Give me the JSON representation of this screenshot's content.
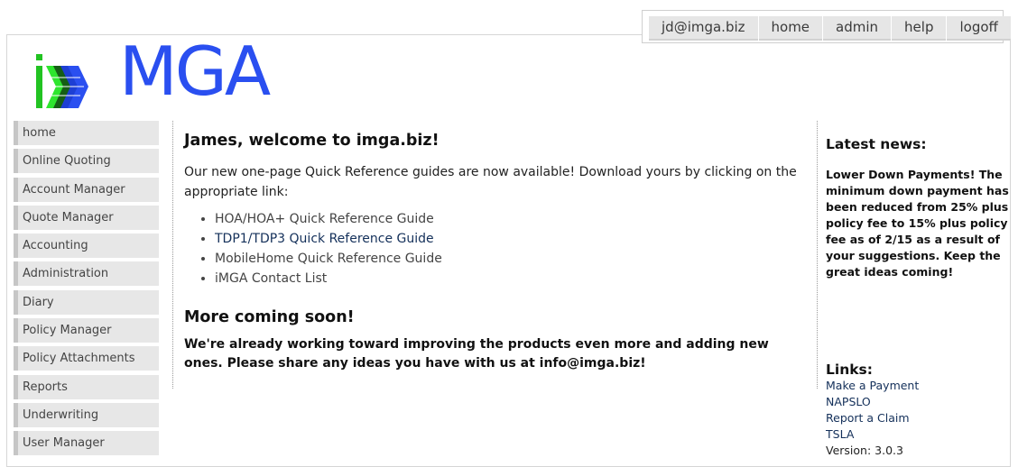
{
  "topnav": {
    "items": [
      "jd@imga.biz",
      "home",
      "admin",
      "help",
      "logoff"
    ]
  },
  "logo": {
    "text": "MGA",
    "i_color": "#22c322",
    "brand_color": "#2a4ff0"
  },
  "sidebar": {
    "items": [
      {
        "label": "home"
      },
      {
        "label": "Online Quoting"
      },
      {
        "label": "Account Manager"
      },
      {
        "label": "Quote Manager"
      },
      {
        "label": "Accounting"
      },
      {
        "label": "Administration"
      },
      {
        "label": "Diary"
      },
      {
        "label": "Policy Manager"
      },
      {
        "label": "Policy Attachments"
      },
      {
        "label": "Reports"
      },
      {
        "label": "Underwriting"
      },
      {
        "label": "User Manager"
      }
    ]
  },
  "main": {
    "title": "James, welcome to imga.biz!",
    "intro": "Our new one-page Quick Reference guides are now available! Download yours by clicking on the appropriate link:",
    "guides": [
      "HOA/HOA+ Quick Reference Guide",
      "TDP1/TDP3 Quick Reference Guide",
      "MobileHome Quick Reference Guide",
      "iMGA Contact List"
    ],
    "coming_title": "More coming soon!",
    "coming_text": "We're already working toward improving the products even more and adding new ones. Please share any ideas you have with us at info@imga.biz!"
  },
  "right": {
    "news_title": "Latest news:",
    "news_text": "Lower Down Payments! The minimum down payment has been reduced from 25% plus policy fee to 15% plus policy fee as of 2/15 as a result of your suggestions. Keep the great ideas coming!",
    "links_title": "Links:",
    "links": [
      "Make a Payment",
      "NAPSLO",
      "Report a Claim",
      "TSLA"
    ],
    "version": "Version: 3.0.3"
  }
}
